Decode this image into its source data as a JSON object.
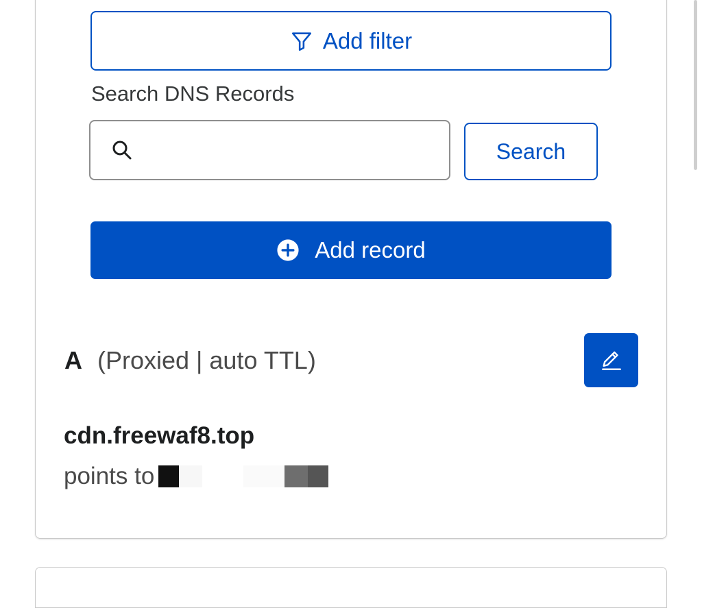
{
  "filter": {
    "add_filter_label": "Add filter",
    "icon": "filter-icon"
  },
  "search": {
    "label": "Search DNS Records",
    "value": "",
    "placeholder": "",
    "button_label": "Search",
    "icon": "search-icon"
  },
  "add_record": {
    "label": "Add record",
    "icon": "plus-circle-icon"
  },
  "record": {
    "type": "A",
    "meta": "(Proxied | auto TTL)",
    "name": "cdn.freewaf8.top",
    "target_prefix": "points to",
    "target_value_redacted": true,
    "edit_icon": "pencil-icon"
  },
  "colors": {
    "primary": "#0051c3",
    "border": "#c9c9c9",
    "text": "#313131"
  }
}
